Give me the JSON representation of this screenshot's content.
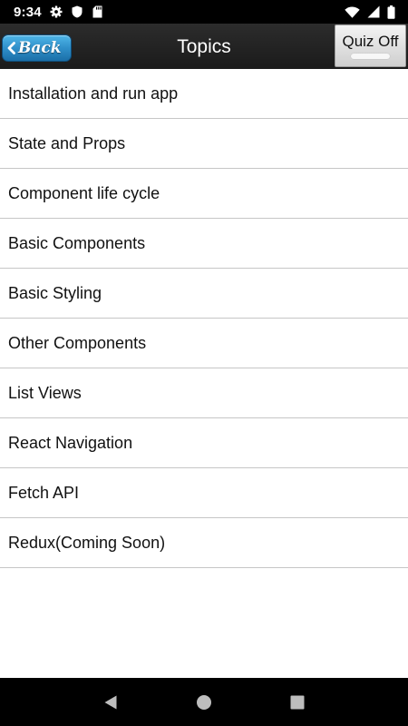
{
  "status_bar": {
    "time": "9:34",
    "left_icons": [
      "gear-icon",
      "shield-icon",
      "sd-card-icon"
    ],
    "right_icons": [
      "wifi-icon",
      "signal-icon",
      "battery-icon"
    ]
  },
  "header": {
    "back_label": "Back",
    "title": "Topics",
    "quiz_label": "Quiz Off"
  },
  "topics": [
    {
      "label": "Installation and run app"
    },
    {
      "label": "State and Props"
    },
    {
      "label": "Component life cycle"
    },
    {
      "label": "Basic Components"
    },
    {
      "label": "Basic Styling"
    },
    {
      "label": "Other Components"
    },
    {
      "label": "List Views"
    },
    {
      "label": "React Navigation"
    },
    {
      "label": "Fetch API"
    },
    {
      "label": "Redux(Coming Soon)"
    }
  ],
  "nav_bar": {
    "buttons": [
      "back-triangle-icon",
      "home-circle-icon",
      "recents-square-icon"
    ]
  },
  "colors": {
    "header_bg": "#1f1f1f",
    "back_button": "#2f8fc9",
    "divider": "#c6c6c6"
  }
}
